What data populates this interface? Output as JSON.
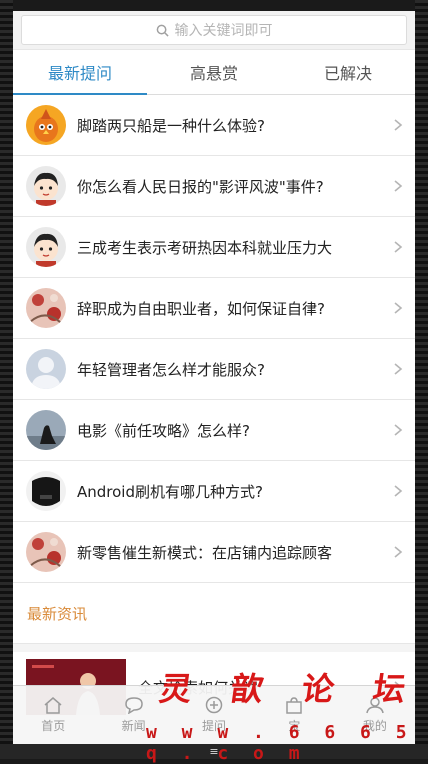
{
  "search": {
    "placeholder": "输入关键词即可"
  },
  "tabs": [
    {
      "label": "最新提问",
      "active": true
    },
    {
      "label": "高悬赏",
      "active": false
    },
    {
      "label": "已解决",
      "active": false
    }
  ],
  "questions": [
    {
      "title": "脚踏两只船是一种什么体验?",
      "avatar": "orange-bird-avatar"
    },
    {
      "title": "你怎么看人民日报的\"影评风波\"事件?",
      "avatar": "cartoon-boy-avatar"
    },
    {
      "title": "三成考生表示考研热因本科就业压力大",
      "avatar": "cartoon-boy-avatar"
    },
    {
      "title": "辞职成为自由职业者，如何保证自律?",
      "avatar": "pink-floral-avatar"
    },
    {
      "title": "年轻管理者怎么样才能服众?",
      "avatar": "default-user-avatar"
    },
    {
      "title": "电影《前任攻略》怎么样?",
      "avatar": "silhouette-photo-avatar"
    },
    {
      "title": "Android刷机有哪几种方式?",
      "avatar": "dark-photo-avatar"
    },
    {
      "title": "新零售催生新模式：在店铺内追踪顾客",
      "avatar": "pink-floral-avatar"
    }
  ],
  "news": {
    "section_title": "最新资讯",
    "items": [
      {
        "title": "全文检索如何关闭"
      }
    ]
  },
  "bottom_nav": [
    {
      "label": "首页",
      "icon": "home-icon"
    },
    {
      "label": "新闻",
      "icon": "chat-icon"
    },
    {
      "label": "提问",
      "icon": "plus-circle-icon"
    },
    {
      "label": "宝",
      "icon": "bag-icon"
    },
    {
      "label": "我的",
      "icon": "user-icon"
    }
  ],
  "watermark": {
    "brand": "灵 歆 论 坛",
    "url": "w w w . 6 6 6 5 q . c o m"
  },
  "colors": {
    "accent": "#2e8ac6",
    "section": "#d98b3a",
    "watermark": "#d81818"
  }
}
